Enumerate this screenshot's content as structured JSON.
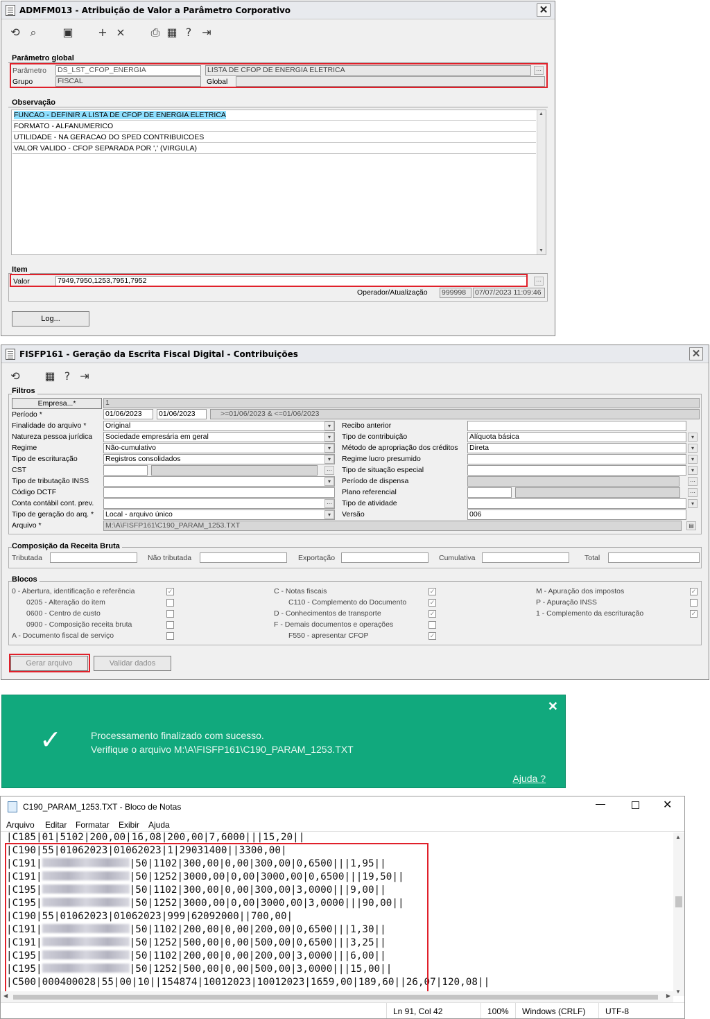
{
  "win1": {
    "title": "ADMFM013 - Atribuição de Valor a Parâmetro Corporativo",
    "close_glyph": "✕",
    "param_section": "Parâmetro global",
    "param_label": "Parâmetro",
    "param_value": "DS_LST_CFOP_ENERGIA",
    "param_desc": "LISTA DE CFOP DE ENERGIA ELETRICA",
    "group_label": "Grupo",
    "group_value": "FISCAL",
    "scope_value": "Global",
    "obs_section": "Observação",
    "obs_lines": [
      "FUNCAO - DEFINIR A LISTA DE CFOP DE ENERGIA ELETRICA",
      "FORMATO - ALFANUMERICO",
      "UTILIDADE - NA GERACAO DO SPED CONTRIBUICOES",
      "VALOR VALIDO - CFOP SEPARADA POR ',' (VIRGULA)"
    ],
    "item_section": "Item",
    "valor_label": "Valor",
    "valor_value": "7949,7950,1253,7951,7952",
    "operator_label": "Operador/Atualização",
    "operator_value": "999998",
    "updated_value": "07/07/2023 11:09:46",
    "log_button": "Log..."
  },
  "win2": {
    "title": "FISFP161 - Geração da Escrita Fiscal Digital - Contribuições",
    "filters_section": "Filtros",
    "empresa_button": "Empresa...*",
    "empresa_value": "1",
    "periodo_label": "Período *",
    "periodo_from": "01/06/2023",
    "periodo_to": "01/06/2023",
    "periodo_expr": ">=01/06/2023 & <=01/06/2023",
    "left_labels": [
      "Finalidade do arquivo *",
      "Natureza pessoa jurídica",
      "Regime",
      "Tipo de escrituração",
      "CST",
      "Tipo de tributação INSS",
      "Código DCTF",
      "Conta contábil cont. prev.",
      "Tipo de geração do arq. *",
      "Arquivo *"
    ],
    "left_values": [
      "Original",
      "Sociedade empresária em geral",
      "Não-cumulativo",
      "Registros consolidados",
      "",
      "",
      "",
      "",
      "Local - arquivo único",
      "M:\\A\\FISFP161\\C190_PARAM_1253.TXT"
    ],
    "right_labels": [
      "Recibo anterior",
      "Tipo de contribuição",
      "Método de apropriação dos créditos",
      "Regime lucro presumido",
      "Tipo de situação especial",
      "Período de dispensa",
      "Plano referencial",
      "Tipo de atividade",
      "Versão"
    ],
    "right_values": [
      "",
      "Alíquota básica",
      "Direta",
      "",
      "",
      "",
      "",
      "",
      "006"
    ],
    "comp_section": "Composição da Receita Bruta",
    "comp_labels": [
      "Tributada",
      "Não tributada",
      "Exportação",
      "Cumulativa",
      "Total"
    ],
    "blocks_section": "Blocos",
    "blocks_col1": [
      "0 - Abertura, identificação e referência",
      "0205 - Alteração do item",
      "0600 - Centro de custo",
      "0900 - Composição receita bruta",
      "A - Documento fiscal de serviço"
    ],
    "blocks_col2": [
      "C - Notas fiscais",
      "C110 - Complemento do Documento",
      "D - Conhecimentos de transporte",
      "F - Demais documentos e operações",
      "F550 - apresentar CFOP"
    ],
    "blocks_col3": [
      "M - Apuração dos impostos",
      "P - Apuração INSS",
      "1 - Complemento da escrituração"
    ],
    "check_glyph": "✓",
    "generate_button": "Gerar arquivo",
    "validate_button": "Validar dados"
  },
  "toast": {
    "line1": "Processamento finalizado com sucesso.",
    "line2": "Verifique o arquivo M:\\A\\FISFP161\\C190_PARAM_1253.TXT",
    "help_link": "Ajuda ?",
    "close_glyph": "✕",
    "check_glyph": "✓",
    "bg_color": "#11a97d"
  },
  "notepad": {
    "title": "C190_PARAM_1253.TXT - Bloco de Notas",
    "menu": [
      "Arquivo",
      "Editar",
      "Formatar",
      "Exibir",
      "Ajuda"
    ],
    "lines": [
      {
        "pre": "|C185|01|5102|200,00|16,08|200,00|7,6000|||15,20||",
        "post": ""
      },
      {
        "pre": "|C190|55|01062023|01062023|1|29031400||3300,00|",
        "post": ""
      },
      {
        "pre": "|C191|",
        "post": "|50|1102|300,00|0,00|300,00|0,6500|||1,95||"
      },
      {
        "pre": "|C191|",
        "post": "|50|1252|3000,00|0,00|3000,00|0,6500|||19,50||"
      },
      {
        "pre": "|C195|",
        "post": "|50|1102|300,00|0,00|300,00|3,0000|||9,00||"
      },
      {
        "pre": "|C195|",
        "post": "|50|1252|3000,00|0,00|3000,00|3,0000|||90,00||"
      },
      {
        "pre": "|C190|55|01062023|01062023|999|62092000||700,00|",
        "post": ""
      },
      {
        "pre": "|C191|",
        "post": "|50|1102|200,00|0,00|200,00|0,6500|||1,30||"
      },
      {
        "pre": "|C191|",
        "post": "|50|1252|500,00|0,00|500,00|0,6500|||3,25||"
      },
      {
        "pre": "|C195|",
        "post": "|50|1102|200,00|0,00|200,00|3,0000|||6,00||"
      },
      {
        "pre": "|C195|",
        "post": "|50|1252|500,00|0,00|500,00|3,0000|||15,00||"
      },
      {
        "pre": "|C500|000400028|55|00|10||154874|10012023|10012023|1659,00|189,60||26,07|120,08||",
        "post": ""
      }
    ],
    "status_position": "Ln 91, Col 42",
    "status_zoom": "100%",
    "status_eol": "Windows (CRLF)",
    "status_encoding": "UTF-8"
  },
  "colors": {
    "highlight_red": "#e0202a",
    "selection_blue": "#8fe0ff"
  }
}
